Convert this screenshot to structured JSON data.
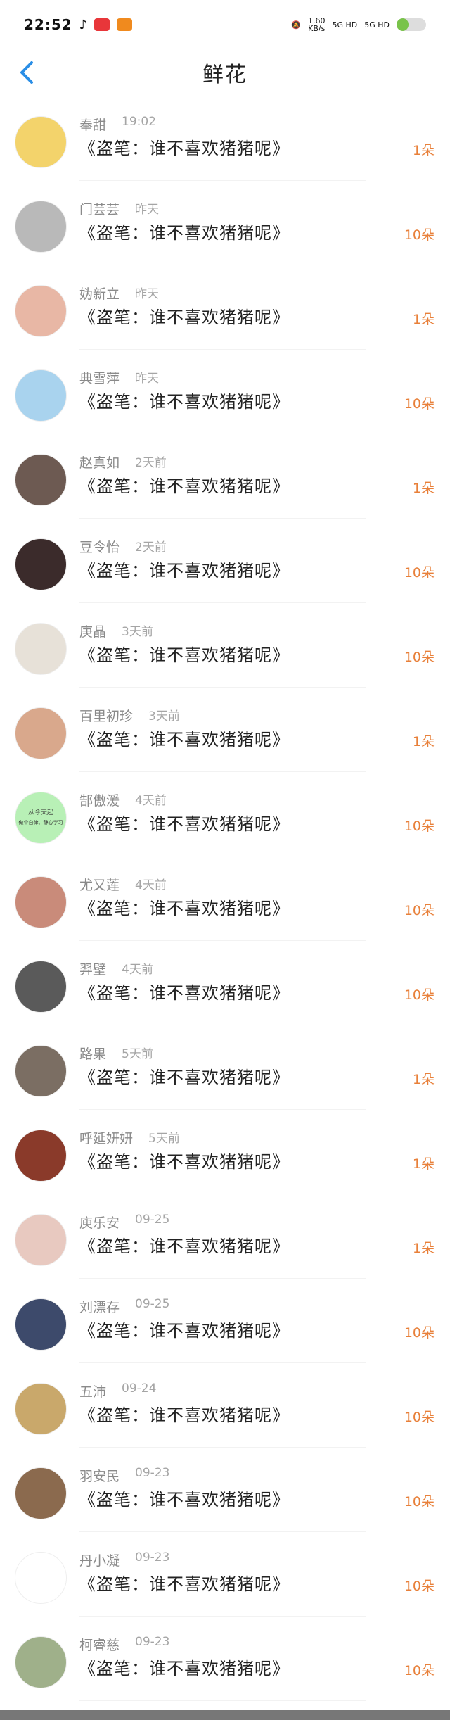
{
  "status_bar": {
    "time": "22:52",
    "net_speed_value": "1.60",
    "net_speed_unit": "KB/s",
    "signal_1": "5G HD",
    "signal_2": "5G HD"
  },
  "header": {
    "title": "鲜花"
  },
  "flowers": [
    {
      "name": "奉甜",
      "time": "19:02",
      "title": "《盗笔：谁不喜欢猪猪呢》",
      "count": "1朵",
      "avatar_color": "#f3d36b"
    },
    {
      "name": "门芸芸",
      "time": "昨天",
      "title": "《盗笔：谁不喜欢猪猪呢》",
      "count": "10朵",
      "avatar_color": "#b9b9b9"
    },
    {
      "name": "妫新立",
      "time": "昨天",
      "title": "《盗笔：谁不喜欢猪猪呢》",
      "count": "1朵",
      "avatar_color": "#e8b7a5"
    },
    {
      "name": "典雪萍",
      "time": "昨天",
      "title": "《盗笔：谁不喜欢猪猪呢》",
      "count": "10朵",
      "avatar_color": "#a9d3ee"
    },
    {
      "name": "赵真如",
      "time": "2天前",
      "title": "《盗笔：谁不喜欢猪猪呢》",
      "count": "1朵",
      "avatar_color": "#6d5a52"
    },
    {
      "name": "豆令怡",
      "time": "2天前",
      "title": "《盗笔：谁不喜欢猪猪呢》",
      "count": "10朵",
      "avatar_color": "#3b2b2b"
    },
    {
      "name": "庚晶",
      "time": "3天前",
      "title": "《盗笔：谁不喜欢猪猪呢》",
      "count": "10朵",
      "avatar_color": "#e7e1d8"
    },
    {
      "name": "百里初珍",
      "time": "3天前",
      "title": "《盗笔：谁不喜欢猪猪呢》",
      "count": "1朵",
      "avatar_color": "#d9a88c"
    },
    {
      "name": "郜傲湲",
      "time": "4天前",
      "title": "《盗笔：谁不喜欢猪猪呢》",
      "count": "10朵",
      "avatar_color": "#b8f0b6",
      "avatar_text_1": "从今天起",
      "avatar_text_2": "做个自律、静心学习"
    },
    {
      "name": "尤又莲",
      "time": "4天前",
      "title": "《盗笔：谁不喜欢猪猪呢》",
      "count": "10朵",
      "avatar_color": "#c98b7a"
    },
    {
      "name": "羿壁",
      "time": "4天前",
      "title": "《盗笔：谁不喜欢猪猪呢》",
      "count": "10朵",
      "avatar_color": "#5a5a5a"
    },
    {
      "name": "路果",
      "time": "5天前",
      "title": "《盗笔：谁不喜欢猪猪呢》",
      "count": "1朵",
      "avatar_color": "#7b6e63"
    },
    {
      "name": "呼延妍妍",
      "time": "5天前",
      "title": "《盗笔：谁不喜欢猪猪呢》",
      "count": "1朵",
      "avatar_color": "#8a3a2a"
    },
    {
      "name": "庾乐安",
      "time": "09-25",
      "title": "《盗笔：谁不喜欢猪猪呢》",
      "count": "1朵",
      "avatar_color": "#e8c9c0"
    },
    {
      "name": "刘漂存",
      "time": "09-25",
      "title": "《盗笔：谁不喜欢猪猪呢》",
      "count": "10朵",
      "avatar_color": "#3d4a6b"
    },
    {
      "name": "五沛",
      "time": "09-24",
      "title": "《盗笔：谁不喜欢猪猪呢》",
      "count": "10朵",
      "avatar_color": "#c9a86b"
    },
    {
      "name": "羽安民",
      "time": "09-23",
      "title": "《盗笔：谁不喜欢猪猪呢》",
      "count": "10朵",
      "avatar_color": "#8b6a4e"
    },
    {
      "name": "丹小凝",
      "time": "09-23",
      "title": "《盗笔：谁不喜欢猪猪呢》",
      "count": "10朵",
      "avatar_color": "#ffffff"
    },
    {
      "name": "柯睿慈",
      "time": "09-23",
      "title": "《盗笔：谁不喜欢猪猪呢》",
      "count": "10朵",
      "avatar_color": "#9fb08a"
    }
  ]
}
